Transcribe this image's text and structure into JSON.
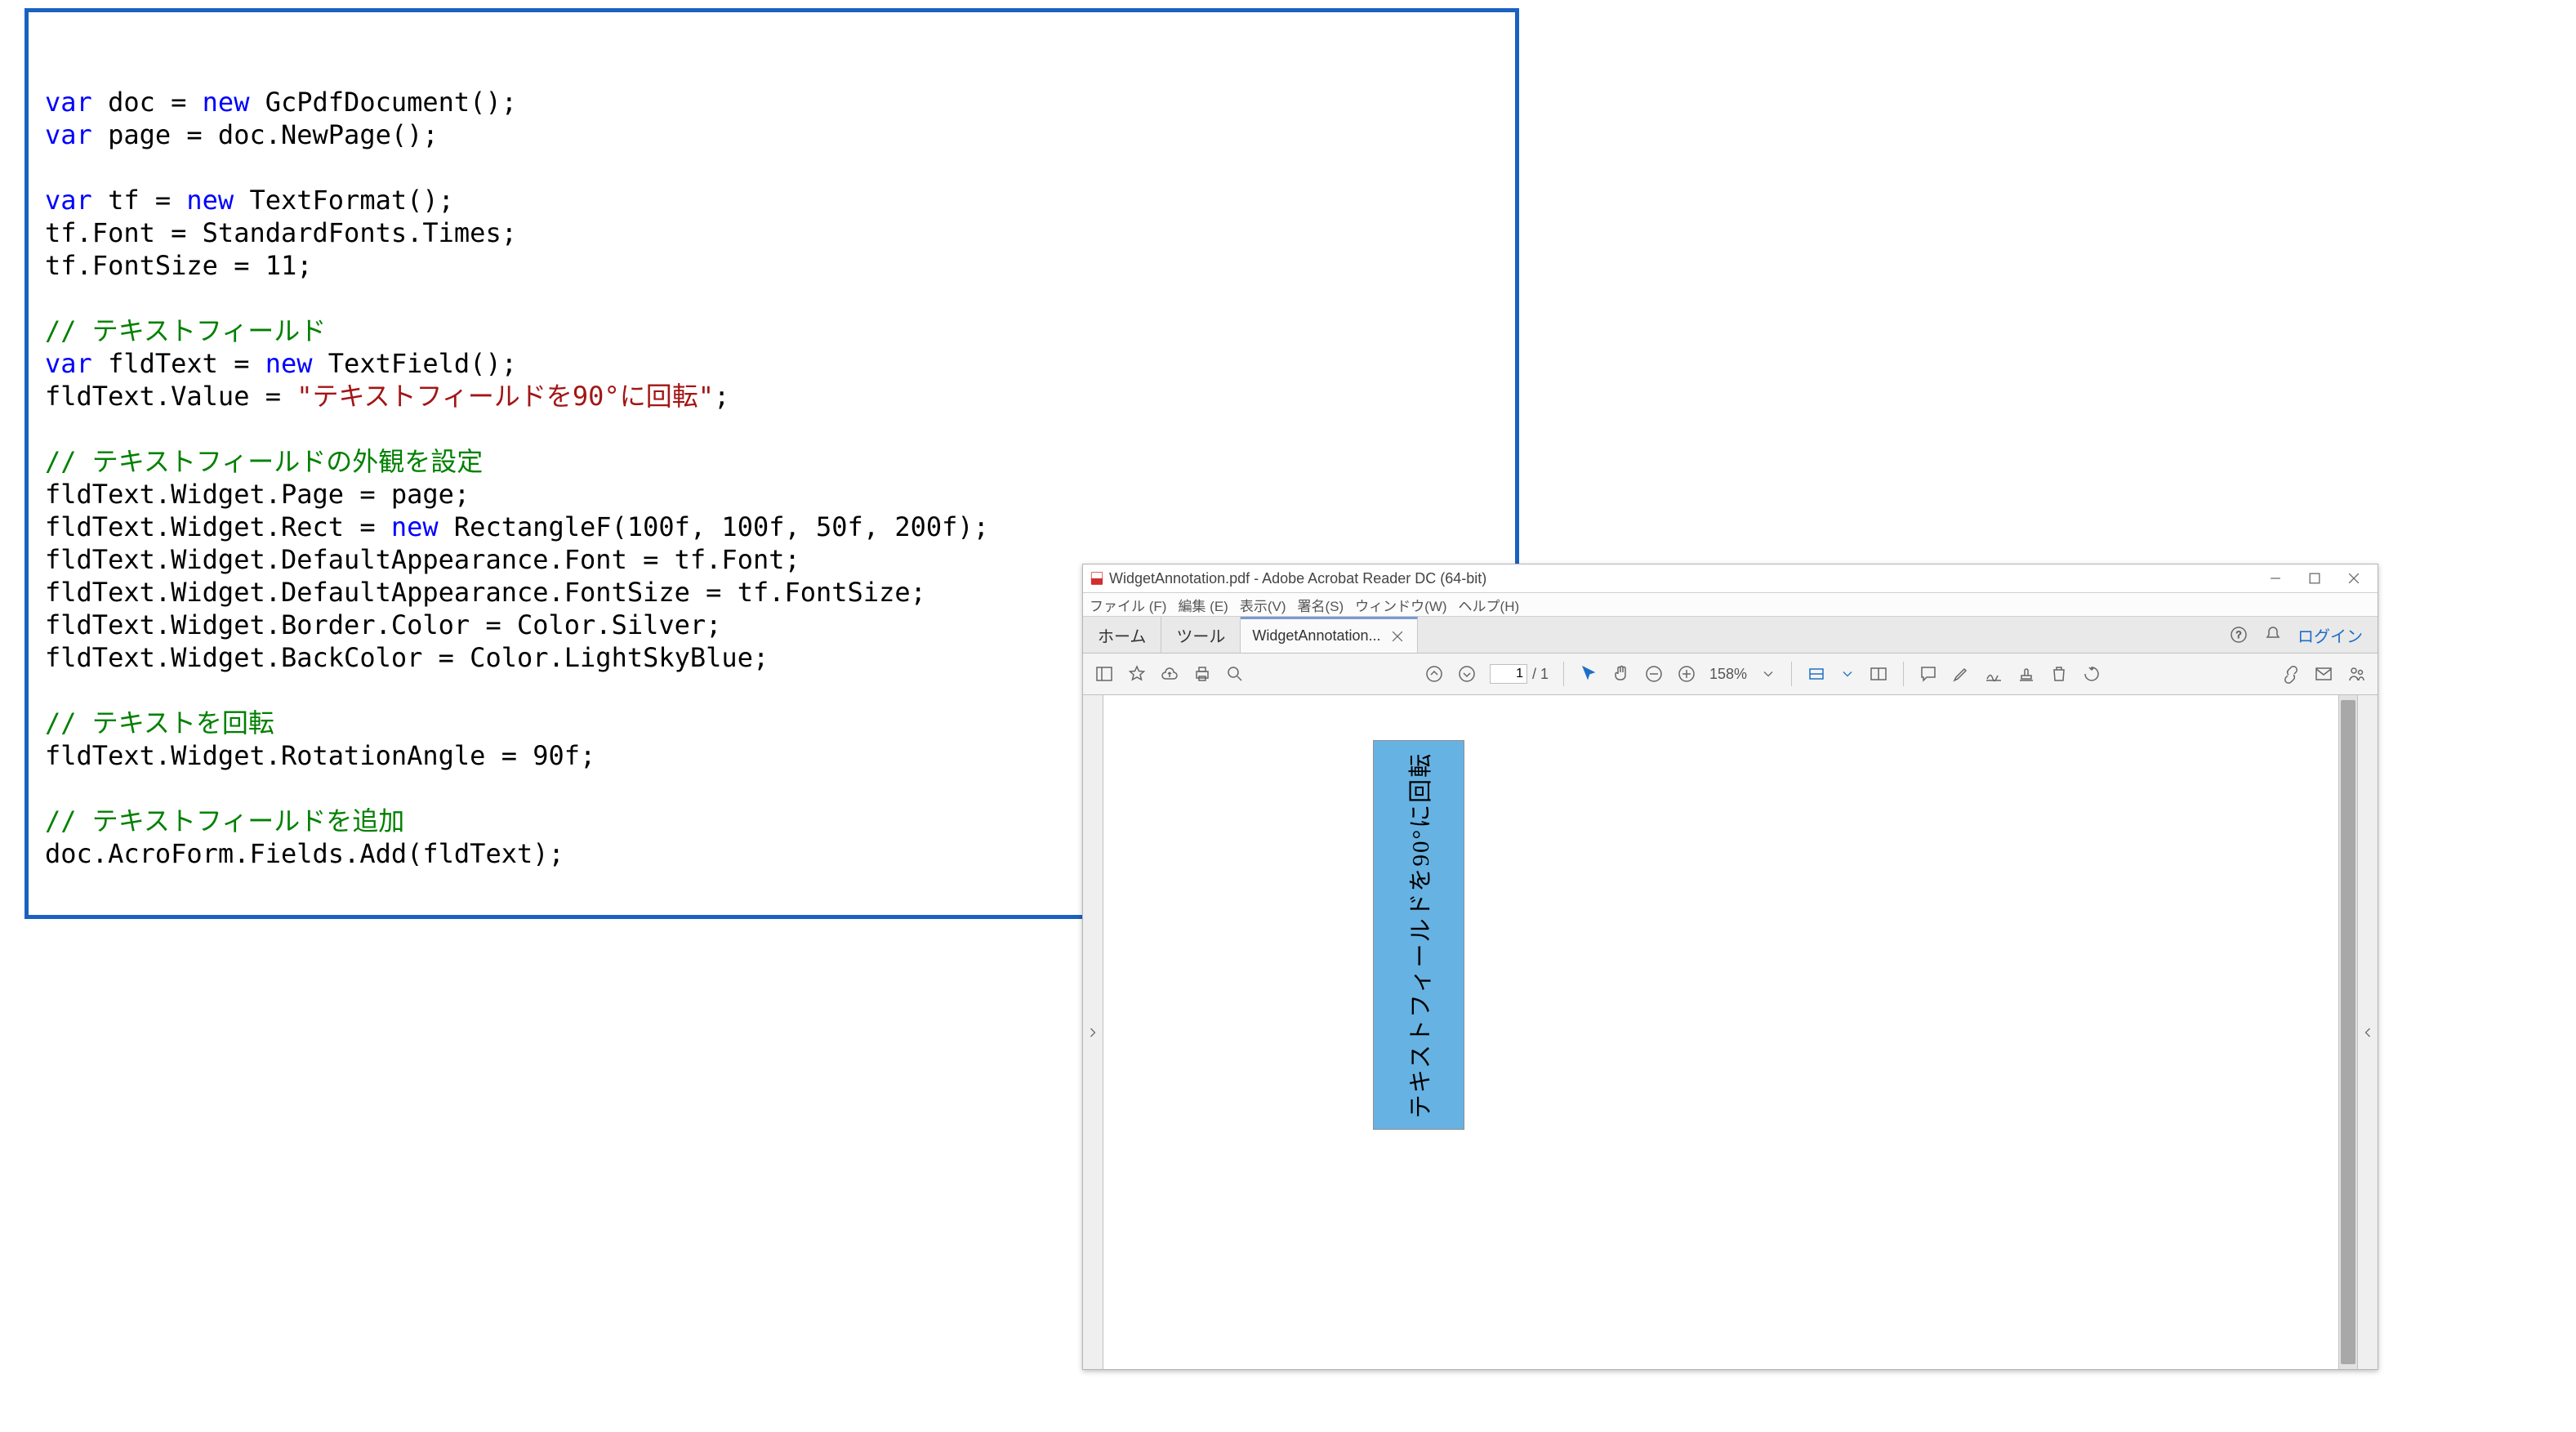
{
  "code": {
    "tokens": [
      [
        {
          "c": "kw",
          "t": "var"
        },
        {
          "t": " doc = "
        },
        {
          "c": "kw",
          "t": "new"
        },
        {
          "t": " GcPdfDocument();"
        }
      ],
      [
        {
          "c": "kw",
          "t": "var"
        },
        {
          "t": " page = doc.NewPage();"
        }
      ],
      [],
      [
        {
          "c": "kw",
          "t": "var"
        },
        {
          "t": " tf = "
        },
        {
          "c": "kw",
          "t": "new"
        },
        {
          "t": " TextFormat();"
        }
      ],
      [
        {
          "t": "tf.Font = StandardFonts.Times;"
        }
      ],
      [
        {
          "t": "tf.FontSize = 11;"
        }
      ],
      [],
      [
        {
          "c": "cm",
          "t": "// テキストフィールド"
        }
      ],
      [
        {
          "c": "kw",
          "t": "var"
        },
        {
          "t": " fldText = "
        },
        {
          "c": "kw",
          "t": "new"
        },
        {
          "t": " TextField();"
        }
      ],
      [
        {
          "t": "fldText.Value = "
        },
        {
          "c": "str",
          "t": "\"テキストフィールドを90°に回転\""
        },
        {
          "t": ";"
        }
      ],
      [],
      [
        {
          "c": "cm",
          "t": "// テキストフィールドの外観を設定"
        }
      ],
      [
        {
          "t": "fldText.Widget.Page = page;"
        }
      ],
      [
        {
          "t": "fldText.Widget.Rect = "
        },
        {
          "c": "kw",
          "t": "new"
        },
        {
          "t": " RectangleF(100f, 100f, 50f, 200f);"
        }
      ],
      [
        {
          "t": "fldText.Widget.DefaultAppearance.Font = tf.Font;"
        }
      ],
      [
        {
          "t": "fldText.Widget.DefaultAppearance.FontSize = tf.FontSize;"
        }
      ],
      [
        {
          "t": "fldText.Widget.Border.Color = Color.Silver;"
        }
      ],
      [
        {
          "t": "fldText.Widget.BackColor = Color.LightSkyBlue;"
        }
      ],
      [],
      [
        {
          "c": "cm",
          "t": "// テキストを回転"
        }
      ],
      [
        {
          "t": "fldText.Widget.RotationAngle = 90f;"
        }
      ],
      [],
      [
        {
          "c": "cm",
          "t": "// テキストフィールドを追加"
        }
      ],
      [
        {
          "t": "doc.AcroForm.Fields.Add(fldText);"
        }
      ]
    ]
  },
  "acrobat": {
    "title": "WidgetAnnotation.pdf - Adobe Acrobat Reader DC (64-bit)",
    "menu": [
      "ファイル (F)",
      "編集 (E)",
      "表示(V)",
      "署名(S)",
      "ウィンドウ(W)",
      "ヘルプ(H)"
    ],
    "tabs": {
      "home": "ホーム",
      "tool": "ツール",
      "doc": "WidgetAnnotation...",
      "login": "ログイン"
    },
    "page": {
      "current": "1",
      "sep": "/ 1"
    },
    "zoom": "158%",
    "field_text": "テキストフィールドを90°に回転"
  }
}
